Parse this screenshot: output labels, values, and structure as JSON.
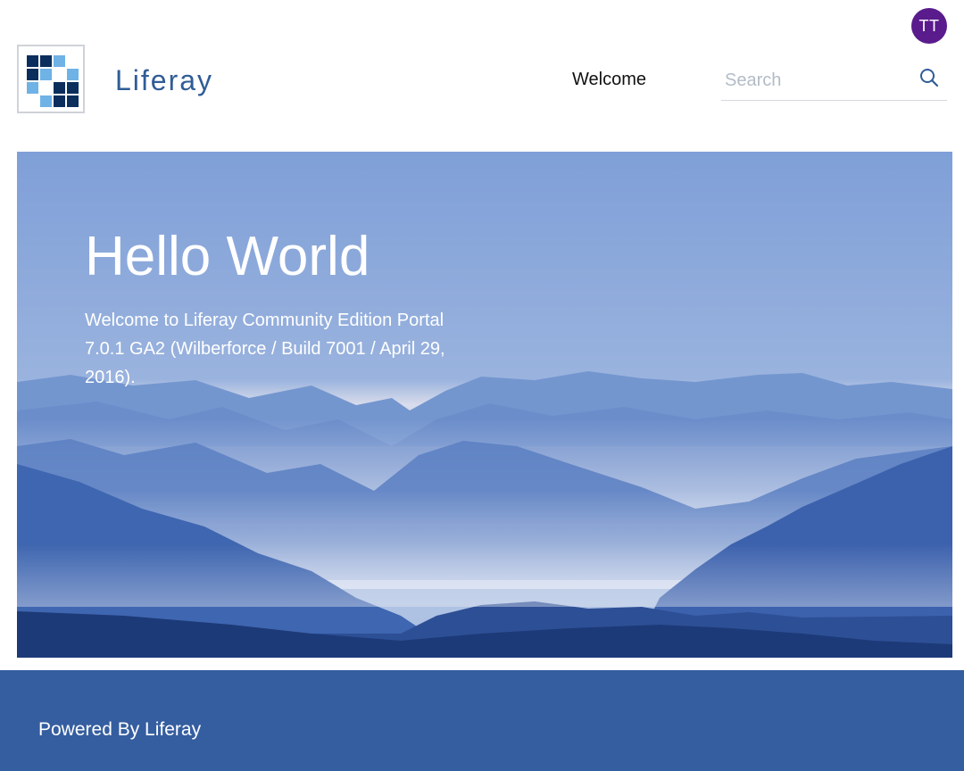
{
  "user": {
    "initials": "TT"
  },
  "header": {
    "site_name": "Liferay",
    "nav": [
      {
        "label": "Welcome"
      }
    ],
    "search": {
      "placeholder": "Search",
      "value": ""
    }
  },
  "hero": {
    "title": "Hello World",
    "text": "Welcome to Liferay Community Edition Portal 7.0.1 GA2 (Wilberforce / Build 7001 / April 29, 2016)."
  },
  "footer": {
    "text": "Powered By Liferay"
  },
  "colors": {
    "brand": "#2f5d96",
    "avatar": "#5a1b8c",
    "footer": "#355ea0",
    "sky": "#85a6db"
  },
  "icons": [
    "liferay-logo-icon",
    "search-icon"
  ]
}
